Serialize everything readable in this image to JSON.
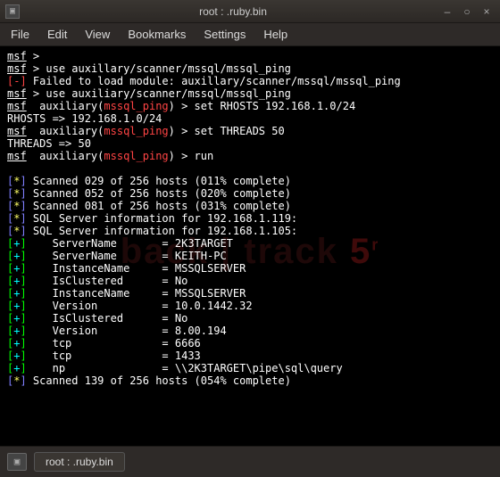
{
  "window": {
    "title": "root : .ruby.bin",
    "buttons": {
      "min": "–",
      "max": "○",
      "close": "×"
    }
  },
  "menu": {
    "file": "File",
    "edit": "Edit",
    "view": "View",
    "bookmarks": "Bookmarks",
    "settings": "Settings",
    "help": "Help"
  },
  "watermark": {
    "text": "back | track ",
    "ver": "5"
  },
  "term": {
    "msf": "msf",
    "gt": " > ",
    "l1_cmd": "use auxillary/scanner/mssql/mssql_ping",
    "l2_pre": "[-]",
    "l2_txt": " Failed to load module: auxillary/scanner/mssql/mssql_ping",
    "l3_cmd": "use auxiliary/scanner/mssql/mssql_ping",
    "aux": "  auxiliary(",
    "ping": "mssql_ping",
    "paren": ") > ",
    "l4_cmd": "set RHOSTS 192.168.1.0/24",
    "l5": "RHOSTS => 192.168.1.0/24",
    "l6_cmd": "set THREADS 50",
    "l7": "THREADS => 50",
    "l8_cmd": "run",
    "star_open": "[",
    "star": "*",
    "star_close": "]",
    "plus": "+",
    "scan1": " Scanned 029 of 256 hosts (011% complete)",
    "scan2": " Scanned 052 of 256 hosts (020% complete)",
    "scan3": " Scanned 081 of 256 hosts (031% complete)",
    "sql1": " SQL Server information for 192.168.1.119:",
    "sql2": " SQL Server information for 192.168.1.105:",
    "r_servername1": "    ServerName       = 2K3TARGET",
    "r_servername2": "    ServerName       = KEITH-PC",
    "r_instance1": "    InstanceName     = MSSQLSERVER",
    "r_clustered1": "    IsClustered      = No",
    "r_instance2": "    InstanceName     = MSSQLSERVER",
    "r_version1": "    Version          = 10.0.1442.32",
    "r_clustered2": "    IsClustered      = No",
    "r_version2": "    Version          = 8.00.194",
    "r_tcp1": "    tcp              = 6666",
    "r_tcp2": "    tcp              = 1433",
    "r_np": "    np               = \\\\2K3TARGET\\pipe\\sql\\query",
    "scan4": " Scanned 139 of 256 hosts (054% complete)"
  },
  "tab": {
    "label": "root : .ruby.bin"
  }
}
